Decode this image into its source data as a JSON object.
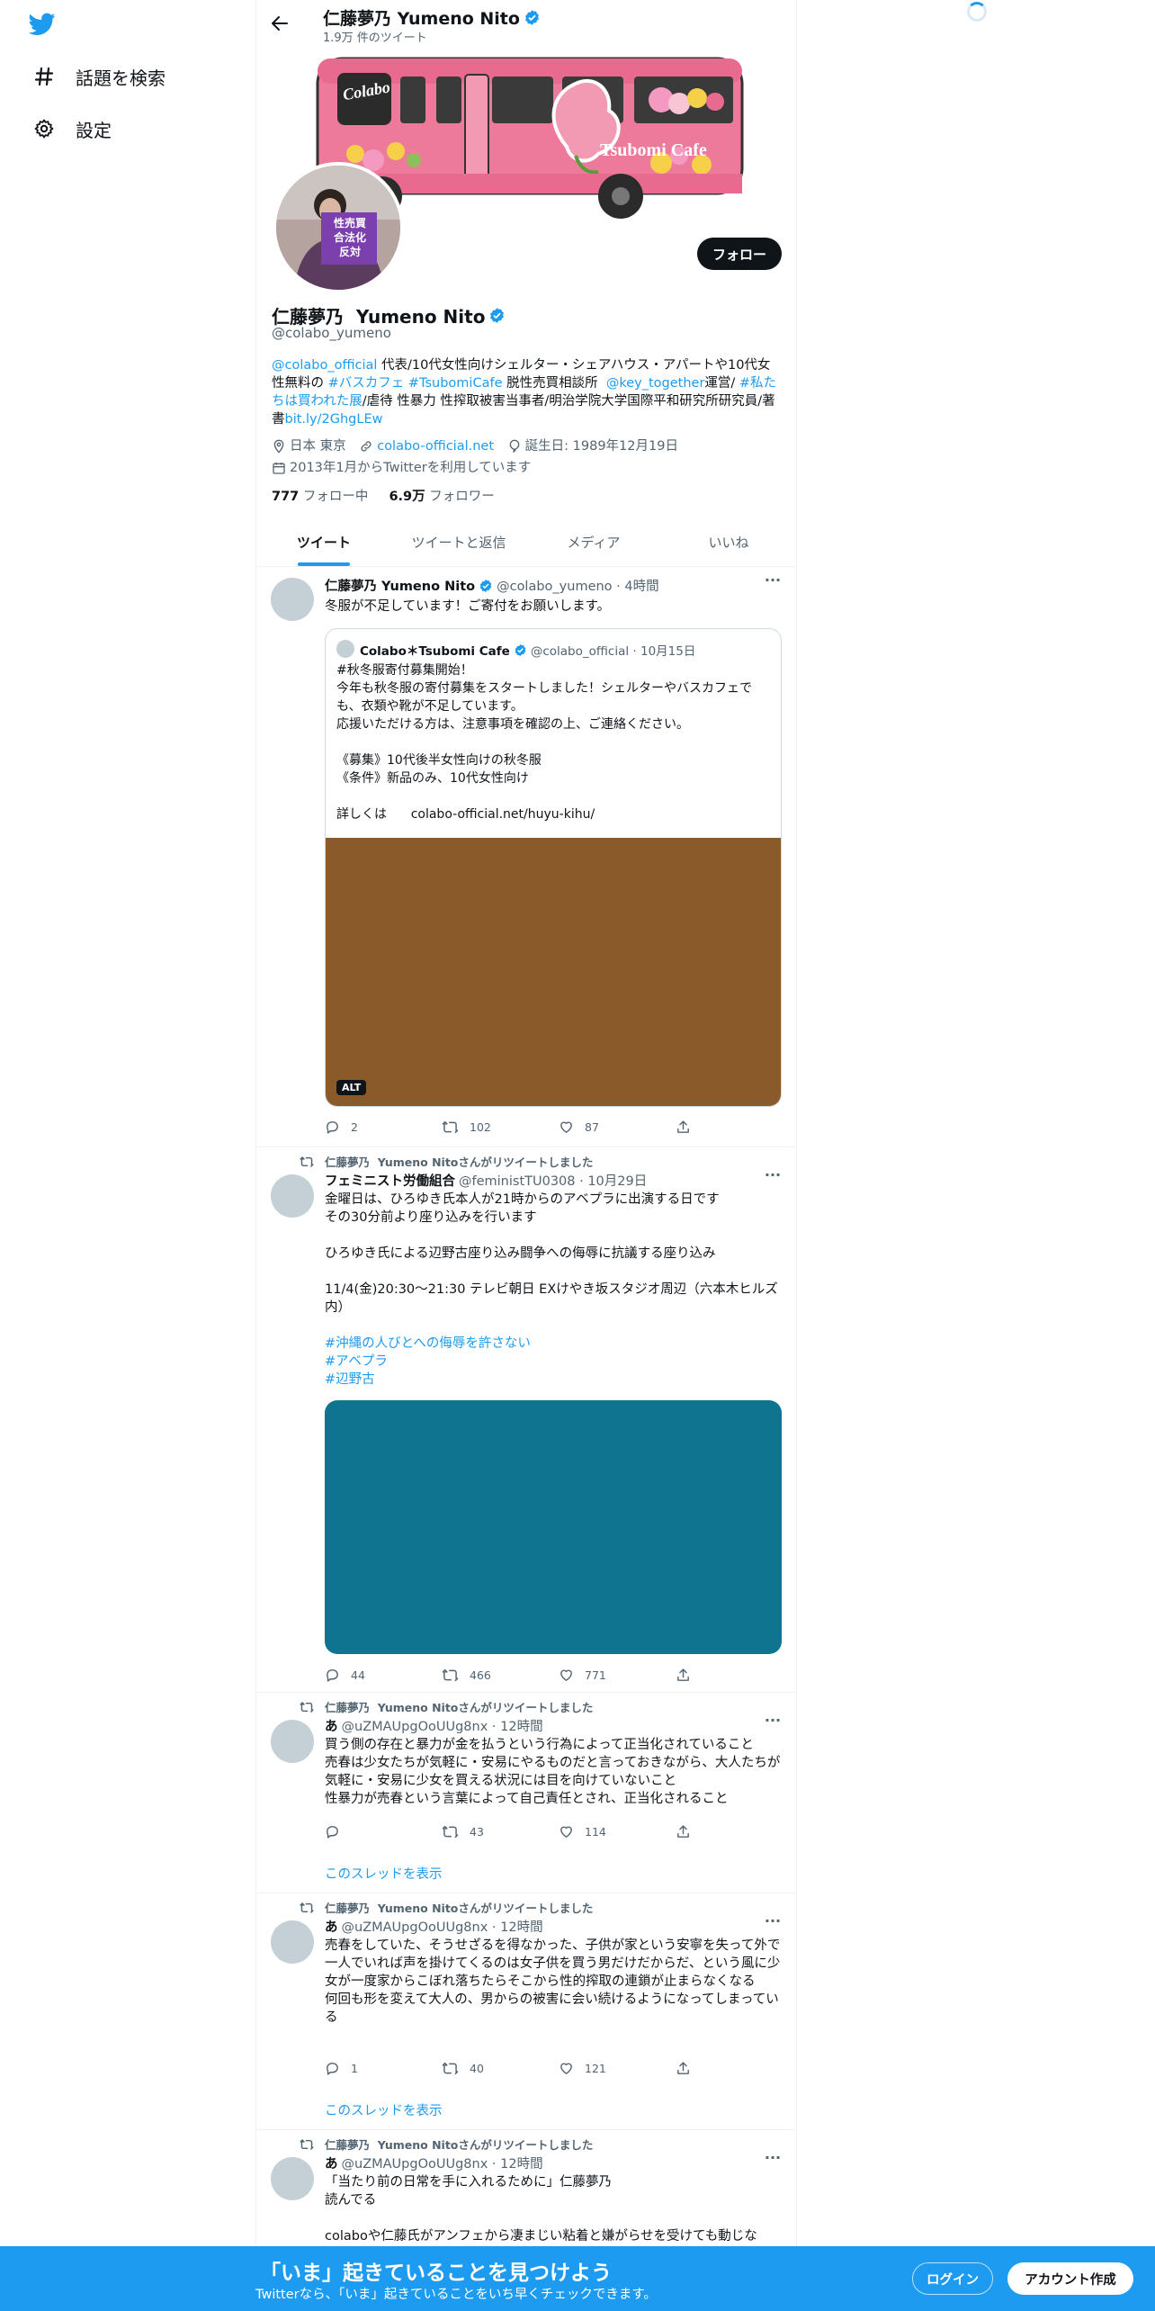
{
  "nav": {
    "explore_label": "話題を検索",
    "settings_label": "設定"
  },
  "header": {
    "name": "仁藤夢乃 Yumeno Nito",
    "tweet_count": "1.9万 件のツイート"
  },
  "banner": {
    "logo_text": "Colabo",
    "cafe_text": "Tsubomi Cafe"
  },
  "avatar_sign": [
    "性売買",
    "合法化",
    "反対"
  ],
  "profile": {
    "name": "仁藤夢乃  Yumeno Nito",
    "handle": "@colabo_yumeno",
    "follow_label": "フォロー",
    "bio": {
      "p1": "@colabo_official",
      "p2": " 代表/10代女性向けシェルター・シェアハウス・アパートや10代女性無料の ",
      "p3": "#バスカフェ",
      "p4": " ",
      "p5": "#TsubomiCafe",
      "p6": " 脱性売買相談所  ",
      "p7": "@key_together",
      "p8": "運営/ ",
      "p9": "#私たちは買われた展",
      "p10": "/虐待 性暴力 性搾取被害当事者/明治学院大学国際平和研究所研究員/著書",
      "p11": "bit.ly/2GhgLEw"
    },
    "location": "日本 東京",
    "url": "colabo-official.net",
    "birthday": "誕生日: 1989年12月19日",
    "joined": "2013年1月からTwitterを利用しています",
    "following_count": "777",
    "following_label": " フォロー中",
    "followers_count": "6.9万",
    "followers_label": " フォロワー"
  },
  "tabs": [
    "ツイート",
    "ツイートと返信",
    "メディア",
    "いいね"
  ],
  "tweets": [
    {
      "name": "仁藤夢乃 Yumeno Nito",
      "handle": "@colabo_yumeno · 4時間",
      "text": "冬服が不足しています！ご寄付をお願いします。",
      "quote": {
        "name": "Colabo＊Tsubomi Cafe",
        "handle": "@colabo_official · 10月15日",
        "text": "#秋冬服寄付募集開始！\n今年も秋冬服の寄付募集をスタートしました！シェルターやバスカフェでも、衣類や靴が不足しています。\n応援いただける方は、注意事項を確認の上、ご連絡ください。\n\n《募集》10代後半女性向けの秋冬服\n《条件》新品のみ、10代女性向け\n\n詳しくは      colabo-official.net/huyu-kihu/",
        "alt": "ALT"
      },
      "replies": "2",
      "retweets": "102",
      "likes": "87"
    },
    {
      "rt_label": "仁藤夢乃  Yumeno Nitoさんがリツイートしました",
      "name": "フェミニスト労働組合",
      "handle": "@feministTU0308 · 10月29日",
      "text": "金曜日は、ひろゆき氏本人が21時からのアベプラに出演する日です\nその30分前より座り込みを行います\n\nひろゆき氏による辺野古座り込み闘争への侮辱に抗議する座り込み\n\n11/4(金)20:30〜21:30 テレビ朝日 EXけやき坂スタジオ周辺（六本木ヒルズ内）",
      "tags": [
        "#沖縄の人びとへの侮辱を許さない",
        "#アベプラ",
        "#辺野古"
      ],
      "replies": "44",
      "retweets": "466",
      "likes": "771"
    },
    {
      "rt_label": "仁藤夢乃  Yumeno Nitoさんがリツイートしました",
      "name": "あ",
      "handle": "@uZMAUpgOoUUg8nx · 12時間",
      "text": "買う側の存在と暴力が金を払うという行為によって正当化されていること\n売春は少女たちが気軽に・安易にやるものだと言っておきながら、大人たちが気軽に・安易に少女を買える状況には目を向けていないこと\n性暴力が売春という言葉によって自己責任とされ、正当化されること",
      "replies": "",
      "retweets": "43",
      "likes": "114",
      "thread": "このスレッドを表示"
    },
    {
      "rt_label": "仁藤夢乃  Yumeno Nitoさんがリツイートしました",
      "name": "あ",
      "handle": "@uZMAUpgOoUUg8nx · 12時間",
      "text": "売春をしていた、そうせざるを得なかった、子供が家という安寧を失って外で一人でいれば声を掛けてくるのは女子供を買う男だけだからだ、という風に少女が一度家からこぼれ落ちたらそこから性的搾取の連鎖が止まらなくなる\n何回も形を変えて大人の、男からの被害に会い続けるようになってしまっている",
      "replies": "1",
      "retweets": "40",
      "likes": "121",
      "thread": "このスレッドを表示"
    },
    {
      "rt_label": "仁藤夢乃  Yumeno Nitoさんがリツイートしました",
      "name": "あ",
      "handle": "@uZMAUpgOoUUg8nx · 12時間",
      "text": "「当たり前の日常を手に入れるために」仁藤夢乃\n読んでる\n\ncolaboや仁藤氏がアンフェから凄まじい粘着と嫌がらせを受けても動じな"
    }
  ],
  "bottom_bar": {
    "title": "「いま」起きていることを見つけよう",
    "subtitle": "Twitterなら、「いま」起きていることをいち早くチェックできます。",
    "login": "ログイン",
    "signup": "アカウント作成"
  },
  "colors": {
    "accent": "#1d9bf0",
    "media1": "#8b5a2b",
    "media2": "#0e7490",
    "bus_pink": "#ee7a9b"
  }
}
